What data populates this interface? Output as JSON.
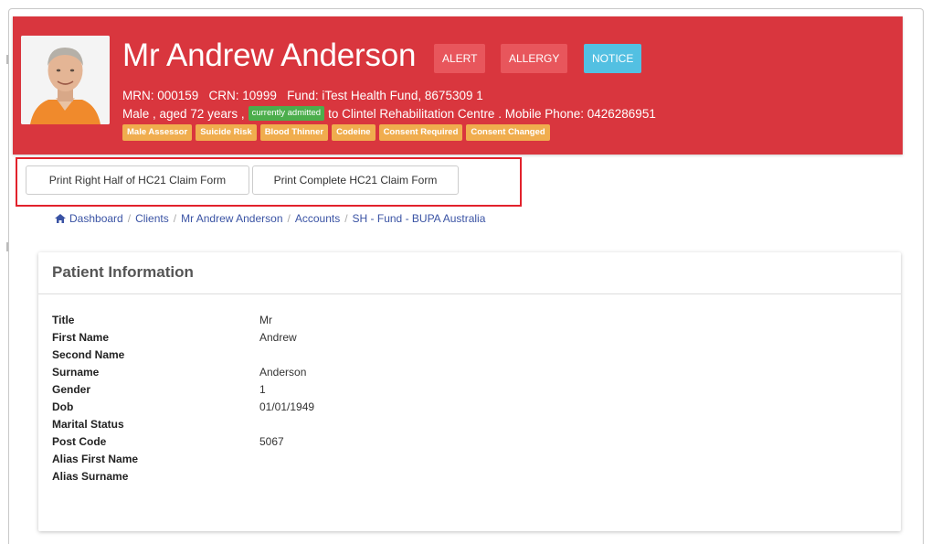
{
  "patient": {
    "name": "Mr Andrew Anderson",
    "tags": {
      "alert": "ALERT",
      "allergy": "ALLERGY",
      "notice": "NOTICE"
    },
    "line1": "MRN: 000159   CRN: 10999   Fund: iTest Health Fund, 8675309 1",
    "line2_prefix": "Male , aged 72 years ,",
    "admitted_badge": "currently admitted",
    "line2_suffix": "to Clintel Rehabilitation Centre . Mobile Phone: 0426286951",
    "flags": [
      "Male Assessor",
      "Suicide Risk",
      "Blood Thinner",
      "Codeine",
      "Consent Required",
      "Consent Changed"
    ],
    "colors": {
      "header": "#d9363e",
      "alert": "#e8565c",
      "notice": "#53c0e2",
      "flag": "#f0ad4e",
      "admitted": "#4cae4c"
    }
  },
  "actions": {
    "print_right": "Print Right Half of HC21 Claim Form",
    "print_complete": "Print Complete HC21 Claim Form"
  },
  "breadcrumb": [
    "Dashboard",
    "Clients",
    "Mr Andrew Anderson",
    "Accounts",
    "SH - Fund - BUPA Australia"
  ],
  "panel": {
    "title": "Patient Information",
    "rows": [
      {
        "label": "Title",
        "value": "Mr"
      },
      {
        "label": "First Name",
        "value": "Andrew"
      },
      {
        "label": "Second Name",
        "value": ""
      },
      {
        "label": "Surname",
        "value": "Anderson"
      },
      {
        "label": "Gender",
        "value": "1"
      },
      {
        "label": "Dob",
        "value": "01/01/1949"
      },
      {
        "label": "Marital Status",
        "value": ""
      },
      {
        "label": "Post Code",
        "value": "5067"
      },
      {
        "label": "Alias First Name",
        "value": ""
      },
      {
        "label": "Alias Surname",
        "value": ""
      }
    ]
  }
}
